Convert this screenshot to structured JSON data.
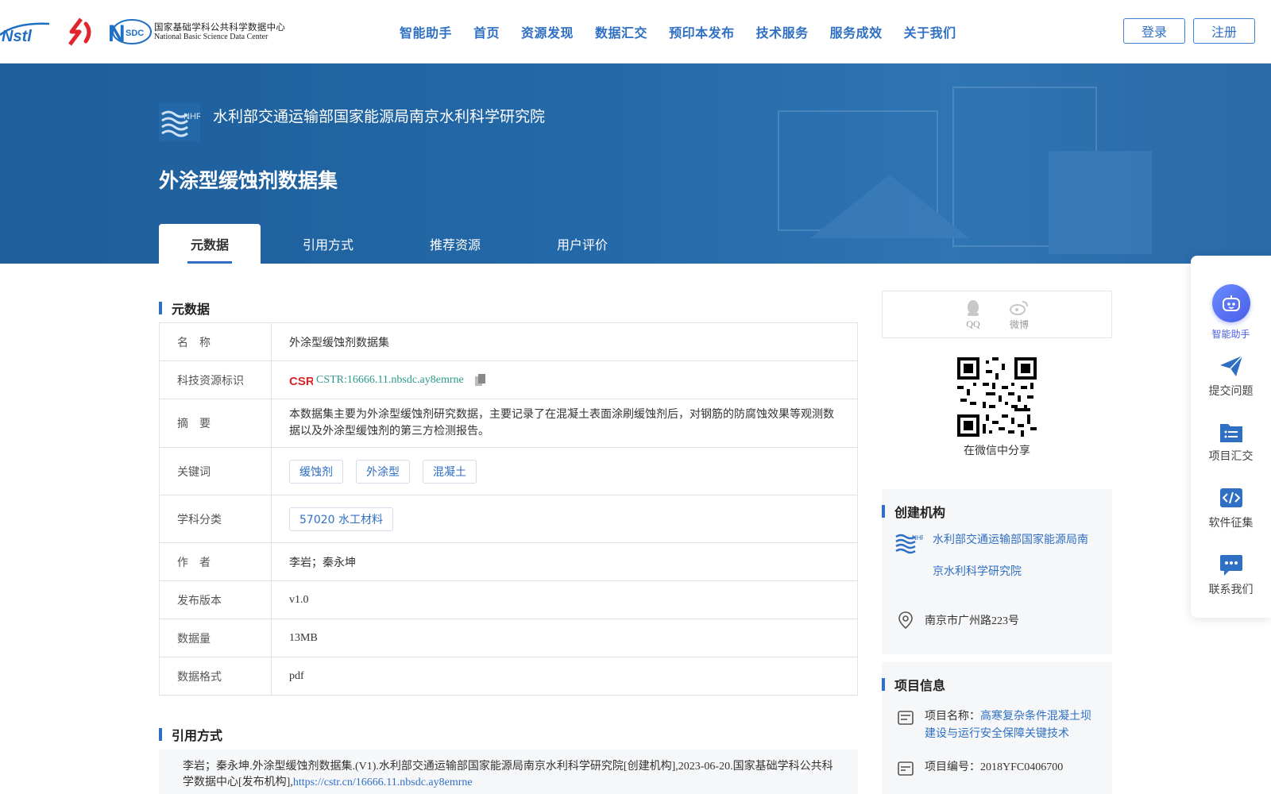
{
  "header": {
    "nav": [
      "智能助手",
      "首页",
      "资源发现",
      "数据汇交",
      "预印本发布",
      "技术服务",
      "服务成效",
      "关于我们"
    ],
    "login": "登录",
    "register": "注册",
    "logo_nsdc_cn": "国家基础学科公共科学数据中心",
    "logo_nsdc_en": "National Basic Science Data Center",
    "logo_nsdc_mark": "SDC"
  },
  "banner": {
    "org_name": "水利部交通运输部国家能源局南京水利科学研究院",
    "dataset_title": "外涂型缓蚀剂数据集",
    "tabs": [
      "元数据",
      "引用方式",
      "推荐资源",
      "用户评价"
    ]
  },
  "metadata": {
    "heading": "元数据",
    "name_key": "名　称",
    "name_val": "外涂型缓蚀剂数据集",
    "cstr_key": "科技资源标识",
    "cstr_val": "CSTR:16666.11.nbsdc.ay8emrne",
    "abstract_key": "摘　要",
    "abstract_val": "本数据集主要为外涂型缓蚀剂研究数据，主要记录了在混凝土表面涂刷缓蚀剂后，对钢筋的防腐蚀效果等观测数据以及外涂型缓蚀剂的第三方检测报告。",
    "keywords_key": "关键词",
    "keywords": [
      "缓蚀剂",
      "外涂型",
      "混凝土"
    ],
    "subject_key": "学科分类",
    "subject_val": "57020 水工材料",
    "author_key": "作　者",
    "author_val": "李岩；秦永坤",
    "version_key": "发布版本",
    "version_val": "v1.0",
    "size_key": "数据量",
    "size_val": "13MB",
    "format_key": "数据格式",
    "format_val": "pdf"
  },
  "citation": {
    "heading": "引用方式",
    "text": "李岩；秦永坤.外涂型缓蚀剂数据集.(V1).水利部交通运输部国家能源局南京水利科学研究院[创建机构],2023-06-20.国家基础学科公共科学数据中心[发布机构],",
    "link": "https://cstr.cn/16666.11.nbsdc.ay8emrne"
  },
  "share": {
    "qq": "QQ",
    "weibo": "微博",
    "wechat_caption": "在微信中分享"
  },
  "org_card": {
    "heading": "创建机构",
    "org_line1": "水利部交通运输部国家能源局南",
    "org_line2": "京水利科学研究院",
    "address": "南京市广州路223号"
  },
  "project_card": {
    "heading": "项目信息",
    "name_label": "项目名称：",
    "name_val": "高寒复杂条件混凝土坝建设与运行安全保障关键技术",
    "id_label": "项目编号：",
    "id_val": "2018YFC0406700"
  },
  "float_panel": {
    "assistant": "智能助手",
    "submit": "提交问题",
    "project": "项目汇交",
    "software": "软件征集",
    "contact": "联系我们"
  },
  "colors": {
    "brand_blue": "#2f6fc4",
    "banner": "#2368a8",
    "cstr_green": "#2a9a8a"
  }
}
